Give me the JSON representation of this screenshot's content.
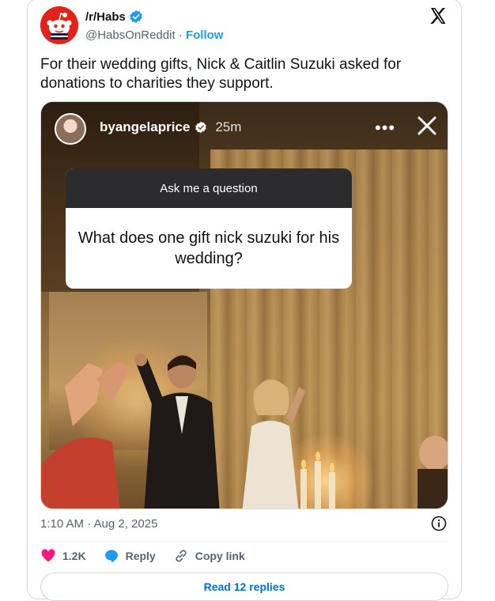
{
  "author": {
    "display_name": "/r/Habs",
    "handle": "@HabsOnReddit",
    "separator": " · ",
    "follow_label": "Follow"
  },
  "tweet": {
    "text": "For their wedding gifts, Nick & Caitlin Suzuki asked for donations to charities they support."
  },
  "story": {
    "username": "byangelaprice",
    "time": "25m",
    "more": "•••",
    "question_header": "Ask me a question",
    "question": "What does one gift nick suzuki for his wedding?"
  },
  "meta": {
    "timestamp": "1:10 AM · Aug 2, 2025"
  },
  "actions": {
    "likes": "1.2K",
    "reply_label": "Reply",
    "copy_label": "Copy link"
  },
  "replies_button": "Read 12 replies",
  "colors": {
    "accent": "#1d9bf0",
    "like": "#f91880",
    "reddit": "#e2231a",
    "muted": "#536471"
  }
}
